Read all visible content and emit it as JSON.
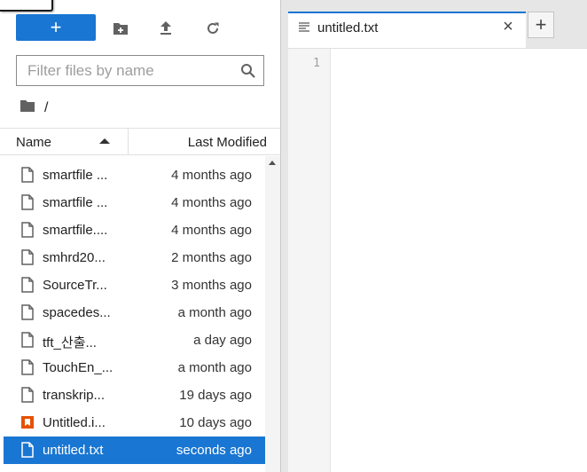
{
  "file_browser": {
    "new_label": "+",
    "filter": {
      "placeholder": "Filter files by name",
      "value": ""
    },
    "breadcrumb": {
      "path": "/"
    },
    "columns": {
      "name": "Name",
      "last_modified": "Last Modified"
    },
    "files": [
      {
        "name": "smartfile ...",
        "modified": "4 months ago",
        "type": "file"
      },
      {
        "name": "smartfile ...",
        "modified": "4 months ago",
        "type": "file"
      },
      {
        "name": "smartfile....",
        "modified": "4 months ago",
        "type": "file"
      },
      {
        "name": "smhrd20...",
        "modified": "2 months ago",
        "type": "file"
      },
      {
        "name": "SourceTr...",
        "modified": "3 months ago",
        "type": "file"
      },
      {
        "name": "spacedes...",
        "modified": "a month ago",
        "type": "file"
      },
      {
        "name": "tft_산출...",
        "modified": "a day ago",
        "type": "file"
      },
      {
        "name": "TouchEn_...",
        "modified": "a month ago",
        "type": "file"
      },
      {
        "name": "transkrip...",
        "modified": "19 days ago",
        "type": "file"
      },
      {
        "name": "Untitled.i...",
        "modified": "10 days ago",
        "type": "notebook"
      },
      {
        "name": "untitled.txt",
        "modified": "seconds ago",
        "type": "file",
        "selected": true
      }
    ]
  },
  "editor": {
    "tab_title": "untitled.txt",
    "close_label": "×",
    "add_tab_label": "+",
    "line_numbers": [
      "1"
    ]
  },
  "colors": {
    "accent": "#1976d2",
    "notebook_icon": "#e65100",
    "dock_background": "#e6e6e6"
  }
}
